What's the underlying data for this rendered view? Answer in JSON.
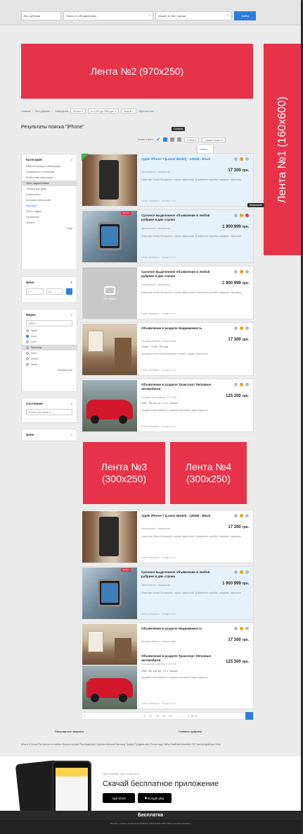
{
  "search": {
    "category": "Все рубрики",
    "query": "Поиск по объявлениям",
    "region": "Искать в",
    "region_value": "Все города",
    "button": "Найти"
  },
  "banners": {
    "b1": "Лента №1 (160x600)",
    "b2": "Лента №2 (970x250)",
    "b3_l1": "Лента №3",
    "b3_l2": "(300x250)",
    "b4_l1": "Лента №4",
    "b4_l2": "(300x250)"
  },
  "crumbs": [
    "Главная",
    "Все рубрики",
    "Смартфоны"
  ],
  "chips": [
    "iPhone",
    "от 1000 до 7000 грн.",
    "новый"
  ],
  "crumb_reset": "Сбросить все",
  "title": "Результаты поиска \"iPhone\"",
  "tooltip_view": "Галерея",
  "tooltip_fav": "Избранное",
  "view": {
    "label": "Только с фото",
    "sort": "Новые",
    "sort2": "Самые новые"
  },
  "sort_options": [
    "Новые",
    "Дешевле",
    "Дороже"
  ],
  "sidebar": {
    "cat_title": "Категория",
    "cat_items": [
      "Комплектующие и аксессуары",
      "Смартфоны и телефоны",
      "Мобильные аксессуары",
      "Часы, аудиотехника",
      "Техника для дома",
      "Компьютеры",
      "Бытовая электроника",
      "Ноутбуки",
      "Фото и видео",
      "Оргтехника",
      "Прочее"
    ],
    "more": "Ещё",
    "price_title": "Цена",
    "price_from": "От",
    "price_to": "До",
    "brand_title": "Марка",
    "brand_search": "Поиск",
    "brands": [
      "Apple",
      "Asus",
      "Acer",
      "Samsung",
      "Sony",
      "Xiaomi",
      "Nokia"
    ],
    "brands_more": "Показать все",
    "cond_title": "Состояние",
    "cond_value": "Любое состояние",
    "price2_title": "Цена"
  },
  "listings": [
    {
      "title": "Apple iPhone 7 (Latest Model) - 128GB - Black",
      "cat": "Электроника › Смартфоны",
      "price": "17 300",
      "cur": "грн.",
      "desc": "Смартфон Nokia N8 красного, корпус идеальный. В комплекте коробка, зарядное, наушники.",
      "meta": "Новые Киевщина · Сегодня, 8:14"
    },
    {
      "title": "Срочное выделенное объявление в любой рубрике в две строки",
      "cat": "Электроника › Смартфоны",
      "price": "1 900 999",
      "cur": "грн.",
      "desc": "Смартфон Nokia N8 красного, корпус идеальный. В комплекте коробка, зарядное, наушники.",
      "meta": "Новые Киевщина · Сегодня, 8:14",
      "badge": "Срочно"
    },
    {
      "title": "Срочное выделенное объявление в любой рубрике в две строки",
      "cat": "Электроника › Смартфоны",
      "price": "1 900 999",
      "cur": "грн.",
      "desc": "Смартфон Nokia N8 красного, корпус идеальный. В комплекте коробка, зарядное, наушники.",
      "meta": "Новые Киевщина · Сегодня, 8:14",
      "noimg": "Нет фото"
    },
    {
      "title": "Объявление в разделе Недвижимость",
      "cat": "Продажа квартир › Новостройки",
      "price": "17 300",
      "cur": "грн.",
      "feat": "3 комн. · 72 м2 · 4/9 этаж",
      "desc": "Продаётся просторная квартира в центре города с ремонтом.",
      "meta": "Новые Киевщина · Сегодня, 8:14"
    },
    {
      "title": "Объявление в разделе Транспорт Легковые автомобили",
      "cat": "Легковые автомобили › TOYOTA",
      "price": "125 300",
      "cur": "грн.",
      "feat": "2008 · 250 тыс. км · 1.4 л · Бензин",
      "desc": "Продаётся автомобиль в хорошем состоянии, один владелец.",
      "meta": "Новые Киевщина · Сегодня, 8:14"
    },
    {
      "title": "Apple iPhone 7 (Latest Model) - 128GB - Black",
      "cat": "Электроника › Смартфоны",
      "price": "17 300",
      "cur": "грн.",
      "desc": "Смартфон Nokia N8 красного, корпус идеальный. В комплекте коробка, зарядное, наушники.",
      "meta": "Новые Киевщина · Сегодня, 8:14"
    },
    {
      "title": "Срочное выделенное объявление в любой рубрике в две строки",
      "cat": "Электроника › Смартфоны",
      "price": "1 900 999",
      "cur": "грн.",
      "desc": "Смартфон Nokia N8 красного, корпус идеальный. В комплекте коробка, зарядное, наушники.",
      "meta": "Новые Киевщина · Сегодня, 8:14",
      "badge": "Срочно"
    },
    {
      "title": "Объявление в разделе Недвижимость",
      "cat": "Продажа квартир › Новостройки",
      "price": "17 300",
      "cur": "грн.",
      "desc": "Продаётся просторная квартира в центре города с ремонтом.",
      "meta": "Новые Киевщина · Сегодня, 8:14"
    },
    {
      "title": "Объявление в разделе Транспорт Легковые автомобили",
      "cat": "Легковые автомобили › TOYOTA",
      "price": "125 300",
      "cur": "грн.",
      "feat": "2008 · 250 тыс. км · 1.4 л · Бензин",
      "desc": "Продаётся автомобиль в хорошем состоянии, один владелец.",
      "meta": "Новые Киевщина · Сегодня, 8:14"
    }
  ],
  "pager": {
    "prev": "<",
    "pages": "1 2 3 4 5 ... 182"
  },
  "popular": {
    "h1": "Популярные запросы",
    "h2": "Главные рубрики",
    "tags": "Iphone 8   Очень   Рыл iphone   на кабель   Мощности   Ipad   Plus   Мода   Ipad 4   Iphone   Motorola   Samsung   Триоды   Продажа авто   Очень надо   Зайти   Бамбони   Mercedes 220   Электроприборы   Mono"
  },
  "app": {
    "small": "Приложение наш смартфон",
    "big": "Скачай бесплатное приложение",
    "appstore": "App Store",
    "gplay": "Google play"
  },
  "footer": {
    "title": "Бесплатка",
    "links": "Помощь и ответы на вопросы   Правила сайта   Карта сайта   Карта региона   Контакты"
  }
}
